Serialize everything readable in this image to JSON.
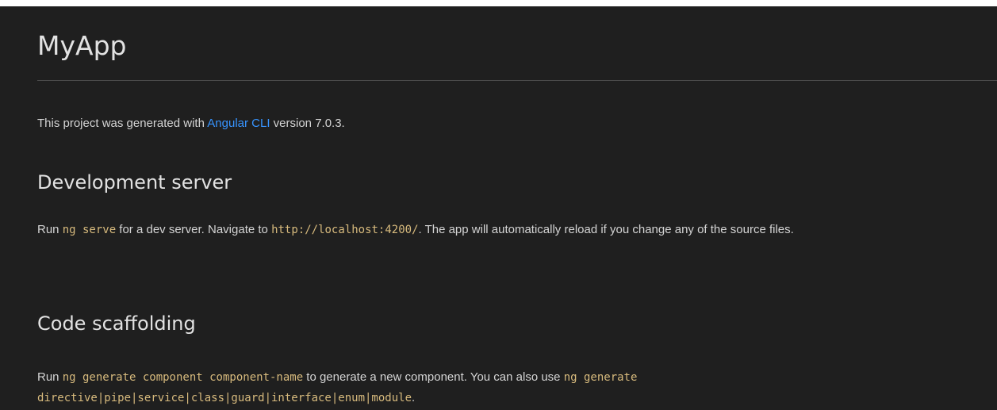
{
  "title": "MyApp",
  "intro": {
    "before": "This project was generated with ",
    "link": "Angular CLI",
    "after": " version 7.0.3."
  },
  "dev_server": {
    "heading": "Development server",
    "run": "Run ",
    "cmd": "ng serve",
    "mid": " for a dev server. Navigate to ",
    "url": "http://localhost:4200/",
    "end": ". The app will automatically reload if you change any of the source files."
  },
  "scaffolding": {
    "heading": "Code scaffolding",
    "run": "Run ",
    "cmd1": "ng generate component component-name",
    "mid": " to generate a new component. You can also use ",
    "cmd2": "ng generate directive|pipe|service|class|guard|interface|enum|module",
    "end": "."
  },
  "colors": {
    "background": "#1f1f1f",
    "text": "#d4d4d4",
    "link": "#3794ff",
    "code": "#d7ba7d"
  }
}
